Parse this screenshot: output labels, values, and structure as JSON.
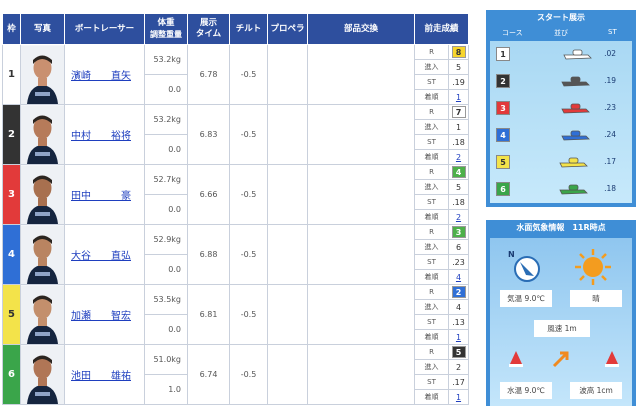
{
  "table": {
    "headers": {
      "waku": "枠",
      "photo": "写真",
      "racer": "ボートレーサー",
      "weight_top": "体重",
      "weight_bottom": "調整重量",
      "tenji_top": "展示",
      "tenji_bottom": "タイム",
      "tilt": "チルト",
      "propeller": "プロペラ",
      "parts": "部品交換",
      "record": "前走成績"
    },
    "record_labels": {
      "r": "R",
      "shinnyu": "進入",
      "st": "ST",
      "chakujun": "着順"
    },
    "rows": [
      {
        "waku": "1",
        "name": "濱崎　　直矢",
        "weight": "53.2kg",
        "adj": "0.0",
        "tenji": "6.78",
        "tilt": "-0.5",
        "r": "8",
        "shinnyu": "5",
        "st": ".19",
        "chakujun": "1",
        "color": "#ffffff",
        "text_color": "#333333",
        "r_bg": "#f7d52c",
        "r_color": "#333333"
      },
      {
        "waku": "2",
        "name": "中村　　裕将",
        "weight": "53.2kg",
        "adj": "0.0",
        "tenji": "6.83",
        "tilt": "-0.5",
        "r": "7",
        "shinnyu": "1",
        "st": ".18",
        "chakujun": "2",
        "color": "#333333",
        "text_color": "#ffffff",
        "r_bg": "#ffffff",
        "r_color": "#333333"
      },
      {
        "waku": "3",
        "name": "田中　　　豪",
        "weight": "52.7kg",
        "adj": "0.0",
        "tenji": "6.66",
        "tilt": "-0.5",
        "r": "4",
        "shinnyu": "5",
        "st": ".18",
        "chakujun": "2",
        "color": "#e23a3a",
        "text_color": "#ffffff",
        "r_bg": "#4db04a",
        "r_color": "#ffffff"
      },
      {
        "waku": "4",
        "name": "大谷　　直弘",
        "weight": "52.9kg",
        "adj": "0.0",
        "tenji": "6.88",
        "tilt": "-0.5",
        "r": "3",
        "shinnyu": "6",
        "st": ".23",
        "chakujun": "4",
        "color": "#2f6fd6",
        "text_color": "#ffffff",
        "r_bg": "#4db04a",
        "r_color": "#ffffff"
      },
      {
        "waku": "5",
        "name": "加瀬　　智宏",
        "weight": "53.5kg",
        "adj": "0.0",
        "tenji": "6.81",
        "tilt": "-0.5",
        "r": "2",
        "shinnyu": "4",
        "st": ".13",
        "chakujun": "1",
        "color": "#f3e34a",
        "text_color": "#333333",
        "r_bg": "#2f6fd6",
        "r_color": "#ffffff"
      },
      {
        "waku": "6",
        "name": "池田　　雄祐",
        "weight": "51.0kg",
        "adj": "1.0",
        "tenji": "6.74",
        "tilt": "-0.5",
        "r": "5",
        "shinnyu": "2",
        "st": ".17",
        "chakujun": "1",
        "color": "#3aa54a",
        "text_color": "#ffffff",
        "r_bg": "#333333",
        "r_color": "#ffffff"
      }
    ]
  },
  "start_display": {
    "title": "スタート展示",
    "col_course": "コース",
    "col_order": "並び",
    "col_st": "ST",
    "lanes": [
      {
        "num": "1",
        "st": ".02",
        "bg": "#ffffff",
        "fg": "#333333",
        "boat_color": "#ffffff"
      },
      {
        "num": "2",
        "st": ".19",
        "bg": "#333333",
        "fg": "#ffffff",
        "boat_color": "#555555"
      },
      {
        "num": "3",
        "st": ".23",
        "bg": "#e23a3a",
        "fg": "#ffffff",
        "boat_color": "#e23a3a"
      },
      {
        "num": "4",
        "st": ".24",
        "bg": "#2f6fd6",
        "fg": "#ffffff",
        "boat_color": "#2f6fd6"
      },
      {
        "num": "5",
        "st": ".17",
        "bg": "#f3e34a",
        "fg": "#333333",
        "boat_color": "#f3e34a"
      },
      {
        "num": "6",
        "st": ".18",
        "bg": "#3aa54a",
        "fg": "#ffffff",
        "boat_color": "#3aa54a"
      }
    ]
  },
  "weather": {
    "title": "水面気象情報　11R時点",
    "wind_dir_letter": "N",
    "air_temp": "気温",
    "air_temp_val": "9.0℃",
    "weather_val": "晴",
    "wind_speed": "風速",
    "wind_speed_val": "1m",
    "water_temp": "水温",
    "water_temp_val": "9.0℃",
    "wave_height": "波高",
    "wave_height_val": "1cm"
  }
}
